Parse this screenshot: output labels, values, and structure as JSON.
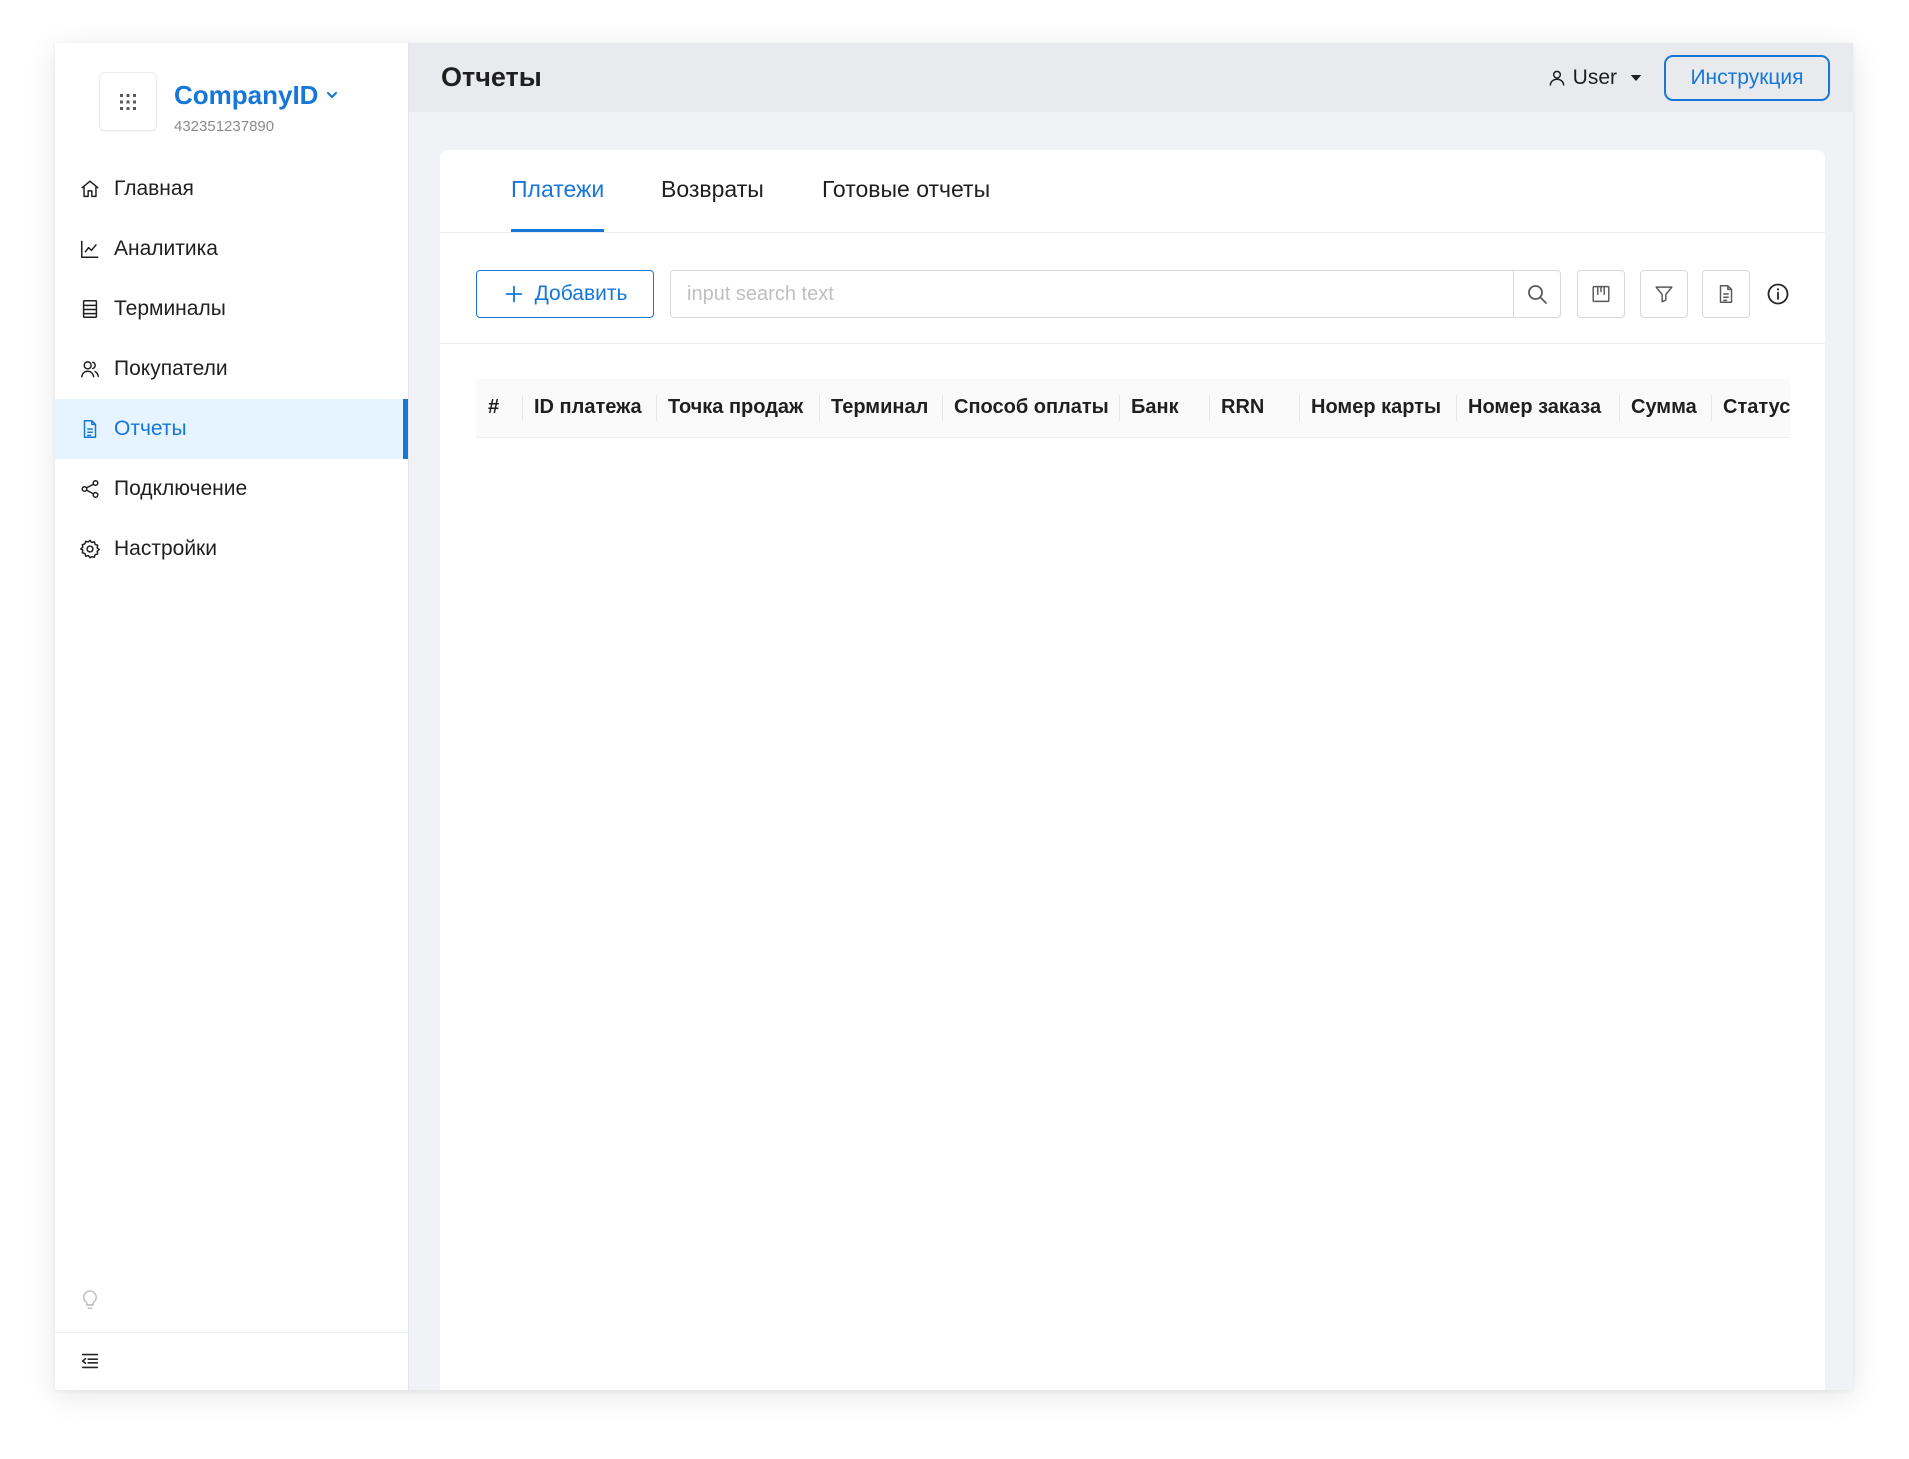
{
  "colors": {
    "accent": "#1677d9",
    "header_bg": "#e8eaed",
    "page_bg": "#f0f2f5",
    "active_bg": "#e6f4ff"
  },
  "sidebar": {
    "logo_icon": "grid-icon",
    "company": {
      "name": "CompanyID",
      "id": "432351237890"
    },
    "nav": [
      {
        "label": "Главная",
        "icon": "home-icon",
        "active": false
      },
      {
        "label": "Аналитика",
        "icon": "line-chart-icon",
        "active": false
      },
      {
        "label": "Терминалы",
        "icon": "terminal-icon",
        "active": false
      },
      {
        "label": "Покупатели",
        "icon": "users-icon",
        "active": false
      },
      {
        "label": "Отчеты",
        "icon": "report-file-icon",
        "active": true
      },
      {
        "label": "Подключение",
        "icon": "share-icon",
        "active": false
      },
      {
        "label": "Настройки",
        "icon": "gear-icon",
        "active": false
      }
    ],
    "footer_icons": [
      "bulb-icon",
      "menu-fold-icon"
    ]
  },
  "header": {
    "title": "Отчеты",
    "user": "User",
    "instruction_label": "Инструкция"
  },
  "tabs": [
    {
      "label": "Платежи",
      "active": true
    },
    {
      "label": "Возвраты",
      "active": false
    },
    {
      "label": "Готовые отчеты",
      "active": false
    }
  ],
  "toolbar": {
    "add_label": "Добавить",
    "search": {
      "placeholder": "input search text",
      "value": ""
    },
    "icons": [
      "search-icon",
      "column-settings-icon",
      "filter-icon",
      "export-file-icon",
      "info-icon"
    ]
  },
  "table": {
    "columns": [
      "#",
      "ID платежа",
      "Точка продаж",
      "Терминал",
      "Способ оплаты",
      "Банк",
      "RRN",
      "Номер карты",
      "Номер заказа",
      "Сумма",
      "Статус"
    ],
    "rows": []
  }
}
